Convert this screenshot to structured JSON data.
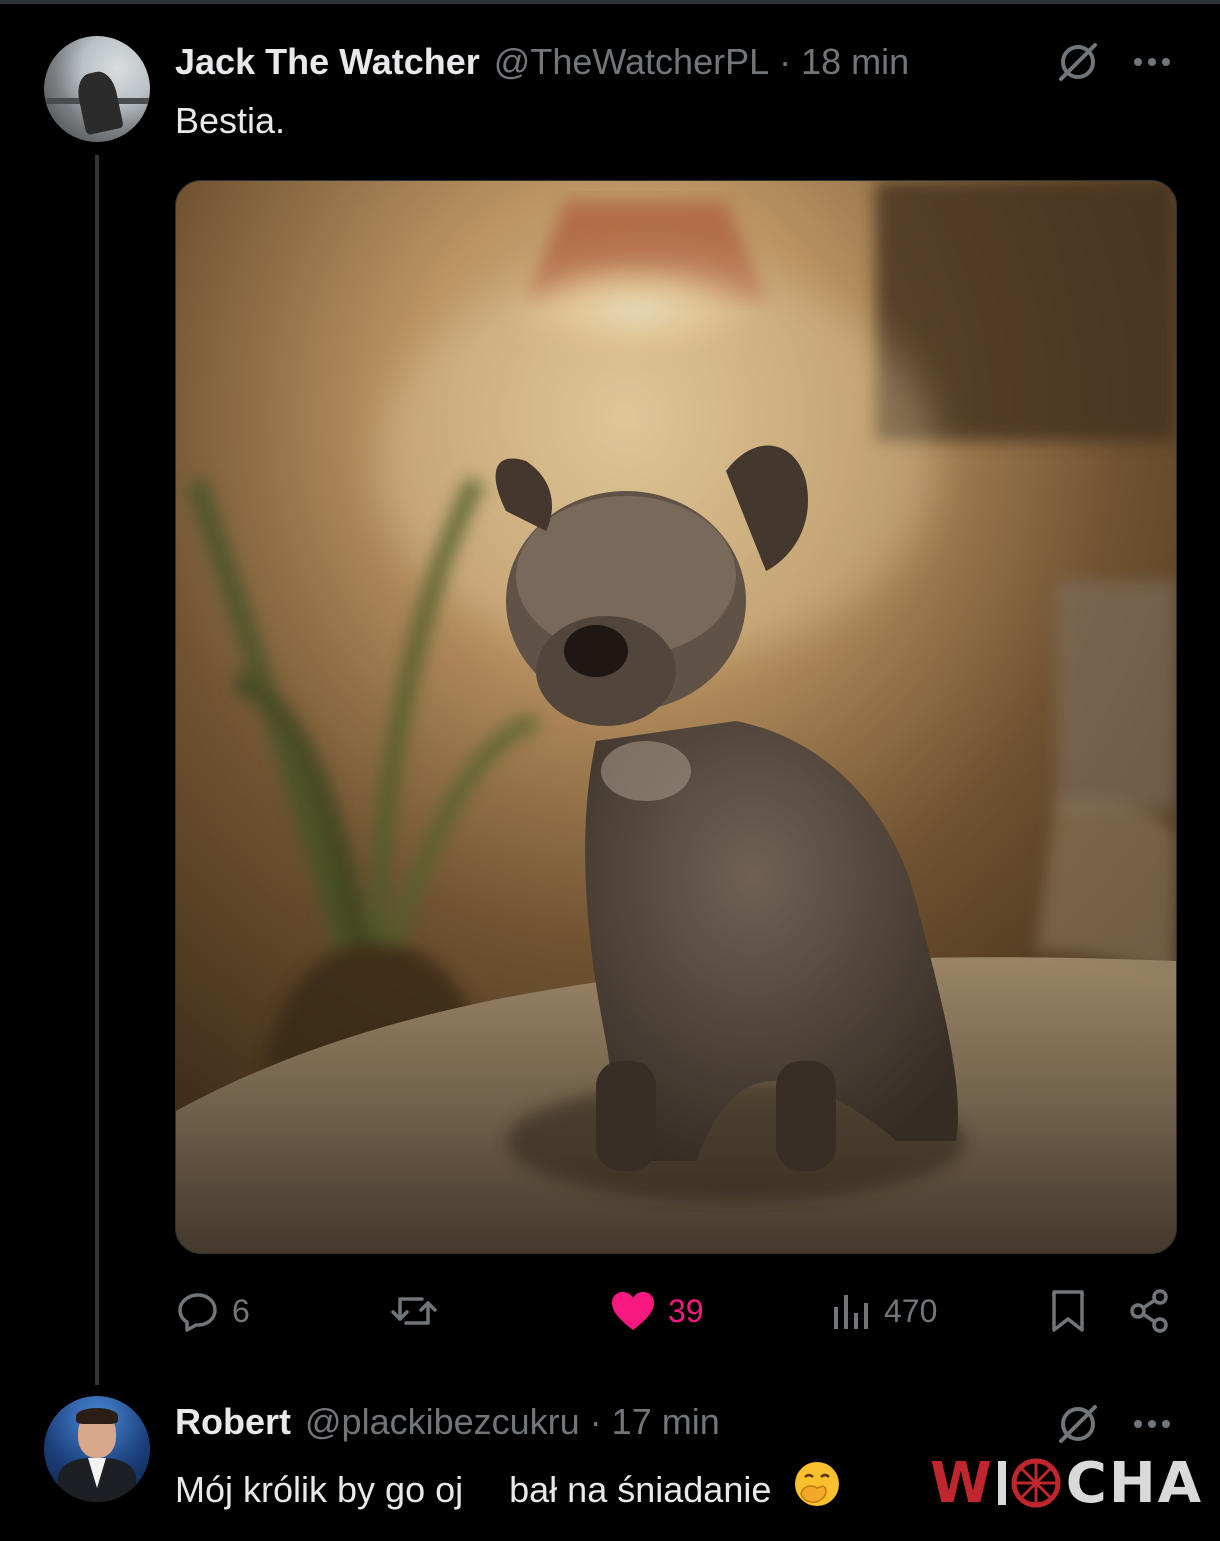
{
  "tweet": {
    "author_name": "Jack The Watcher",
    "handle": "@TheWatcherPL",
    "separator": "·",
    "time": "18 min",
    "text": "Bestia.",
    "media": {
      "alt_icon": "photo-dog-on-couch"
    },
    "actions": {
      "replies": "6",
      "reposts": "",
      "likes": "39",
      "views": "470"
    },
    "like_color": "#f91880"
  },
  "reply": {
    "author_name": "Robert",
    "handle": "@plackibezcukru",
    "separator": "·",
    "time": "17 min",
    "text_part1": "Mój królik by go oj",
    "text_part2": "bał na śniadanie",
    "emoji": "🤭"
  },
  "watermark": {
    "left": "W",
    "right": "CHA",
    "full": "WIOCHA"
  },
  "colors": {
    "background": "#000000",
    "text_primary": "#e7e9ea",
    "text_secondary": "#71767b",
    "watermark_red": "#c0262d"
  }
}
